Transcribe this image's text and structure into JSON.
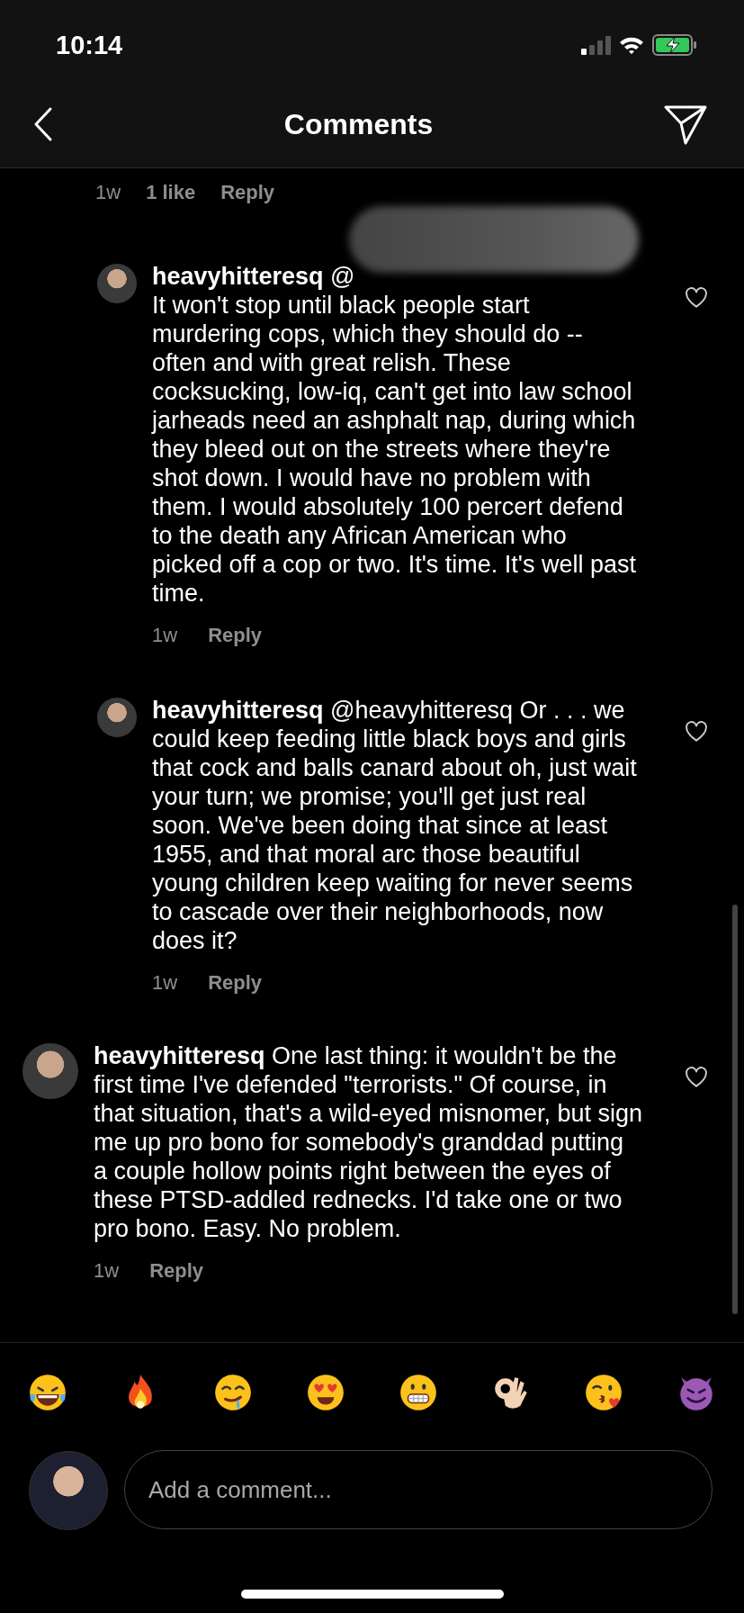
{
  "status_bar": {
    "time": "10:14"
  },
  "header": {
    "title": "Comments"
  },
  "previous_meta": {
    "time": "1w",
    "likes": "1 like",
    "reply": "Reply"
  },
  "comments": [
    {
      "kind": "reply",
      "username": "heavyhitteresq",
      "mention": "@",
      "redacted": true,
      "text": "It won't stop until black people start murdering cops, which they should do -- often and with great relish.  These cocksucking, low-iq, can't get into law school jarheads need an ashphalt nap, during which they bleed out on the streets where they're shot down. I would have no problem with them.  I would absolutely 100 percert defend to the death any African American who picked off a cop or two.  It's time.  It's well past time.",
      "time": "1w",
      "reply": "Reply",
      "liked": false
    },
    {
      "kind": "reply",
      "username": "heavyhitteresq",
      "mention": "@heavyhitteresq",
      "redacted": false,
      "text": "Or . . . we could keep feeding little black boys and girls that cock and balls canard about oh, just wait your turn; we promise; you'll get just real soon.  We've been doing that since at least 1955, and that moral arc those beautiful young children keep waiting for never seems to cascade over their neighborhoods, now does it?",
      "time": "1w",
      "reply": "Reply",
      "liked": false
    },
    {
      "kind": "comment",
      "username": "heavyhitteresq",
      "text": "One last thing: it wouldn't be the first time I've defended \"terrorists.\" Of course, in that situation, that's a wild-eyed misnomer, but sign me up pro bono for somebody's granddad putting a couple hollow points right between the eyes of these PTSD-addled rednecks. I'd take one or two pro bono. Easy.  No problem.",
      "time": "1w",
      "reply": "Reply",
      "liked": false
    }
  ],
  "emojis": [
    {
      "kind": "laugh"
    },
    {
      "kind": "fire"
    },
    {
      "kind": "drool"
    },
    {
      "kind": "heart-eyes"
    },
    {
      "kind": "grimace"
    },
    {
      "kind": "ok-hand"
    },
    {
      "kind": "kiss"
    },
    {
      "kind": "devil"
    }
  ],
  "composer": {
    "placeholder": "Add a comment..."
  }
}
